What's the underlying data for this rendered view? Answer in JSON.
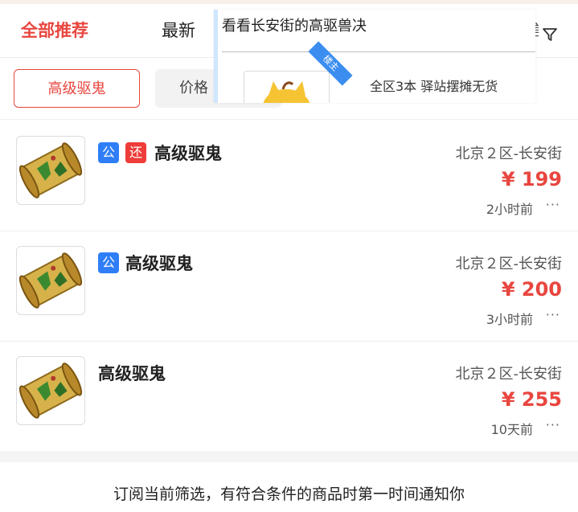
{
  "tabs": {
    "recommended": "全部推荐",
    "latest": "最新",
    "partial": "言"
  },
  "filters": {
    "selected": "高级驱鬼",
    "price": "价格"
  },
  "overlay": {
    "title": "看看长安街的高驱兽决",
    "badge": "楼主",
    "description": "全区3本 驿站摆摊无货"
  },
  "colors": {
    "accent": "#e8463f",
    "tag_gong": "#2f7ef7",
    "tag_huan": "#ee3d3a"
  },
  "items": [
    {
      "tags": [
        "公",
        "还"
      ],
      "name": "高级驱鬼",
      "server": "北京２区-长安街",
      "price": "¥ 199",
      "time": "2小时前",
      "more": "···"
    },
    {
      "tags": [
        "公"
      ],
      "name": "高级驱鬼",
      "server": "北京２区-长安街",
      "price": "¥ 200",
      "time": "3小时前",
      "more": "···"
    },
    {
      "tags": [],
      "name": "高级驱鬼",
      "server": "北京２区-长安街",
      "price": "¥ 255",
      "time": "10天前",
      "more": "···"
    }
  ],
  "subscribe_text": "订阅当前筛选，有符合条件的商品时第一时间通知你",
  "icons": {
    "filter": "filter-funnel-icon",
    "item_image": "scroll-book-icon"
  }
}
